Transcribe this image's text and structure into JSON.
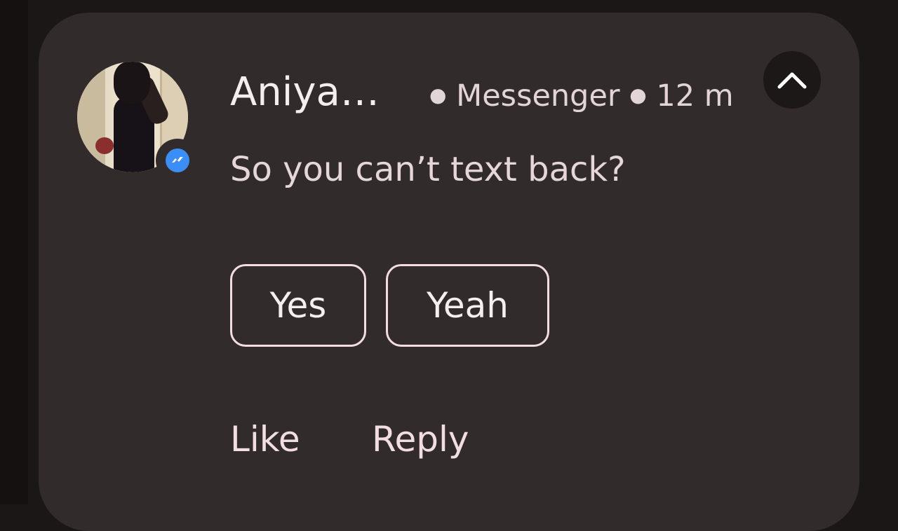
{
  "notification": {
    "sender_name": "Aniya…",
    "app_name": "Messenger",
    "time_ago": "12 m",
    "message": "So you can’t text back?",
    "app_icon": "messenger-icon",
    "collapse_icon": "chevron-up-icon"
  },
  "quick_replies": [
    {
      "label": "Yes"
    },
    {
      "label": "Yeah"
    }
  ],
  "actions": {
    "like_label": "Like",
    "reply_label": "Reply"
  },
  "colors": {
    "card_background": "#312b2b",
    "messenger_blue": "#3a8ef5",
    "chip_border": "#f2dde2"
  }
}
